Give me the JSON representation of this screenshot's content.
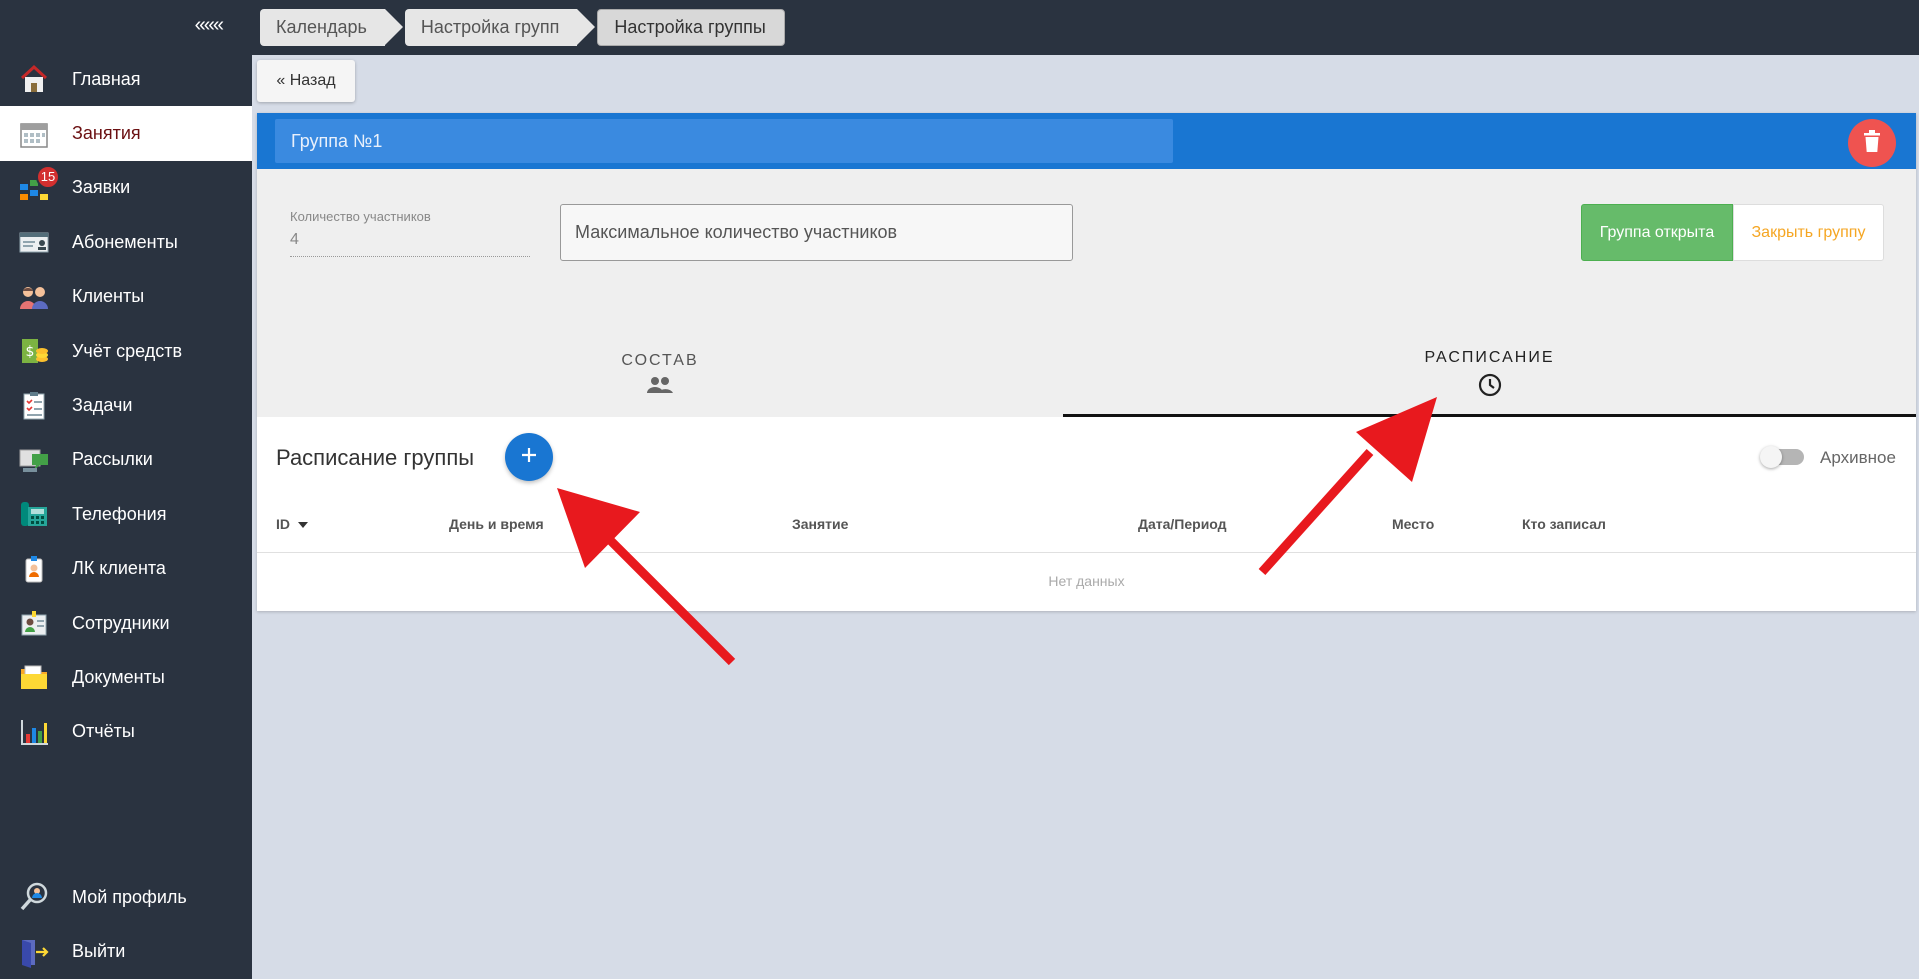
{
  "sidebar": {
    "collapse_label": "«««",
    "items": [
      {
        "label": "Главная",
        "icon": "home-icon"
      },
      {
        "label": "Занятия",
        "icon": "calendar-icon",
        "active": true
      },
      {
        "label": "Заявки",
        "icon": "requests-icon",
        "badge": "15"
      },
      {
        "label": "Абонементы",
        "icon": "subscription-card-icon"
      },
      {
        "label": "Клиенты",
        "icon": "clients-icon"
      },
      {
        "label": "Учёт средств",
        "icon": "money-icon"
      },
      {
        "label": "Задачи",
        "icon": "tasks-clipboard-icon"
      },
      {
        "label": "Рассылки",
        "icon": "mailing-icon"
      },
      {
        "label": "Телефония",
        "icon": "phone-icon"
      },
      {
        "label": "ЛК клиента",
        "icon": "client-account-icon"
      },
      {
        "label": "Сотрудники",
        "icon": "staff-icon"
      },
      {
        "label": "Документы",
        "icon": "documents-folder-icon"
      },
      {
        "label": "Отчёты",
        "icon": "reports-chart-icon"
      }
    ],
    "bottom_items": [
      {
        "label": "Мой профиль",
        "icon": "profile-icon"
      },
      {
        "label": "Выйти",
        "icon": "logout-icon"
      }
    ]
  },
  "breadcrumbs": [
    "Календарь",
    "Настройка групп",
    "Настройка группы"
  ],
  "back_label": "« Назад",
  "group": {
    "name": "Группа №1",
    "count_label": "Количество участников",
    "count_value": "4",
    "max_placeholder": "Максимальное количество участников",
    "open_label": "Группа открыта",
    "close_label": "Закрыть группу"
  },
  "tabs": [
    {
      "label": "СОСТАВ",
      "icon": "people-icon"
    },
    {
      "label": "РАСПИСАНИЕ",
      "icon": "clock-icon",
      "active": true
    }
  ],
  "schedule": {
    "title": "Расписание группы",
    "archive_label": "Архивное",
    "columns": [
      "ID",
      "День и время",
      "Занятие",
      "Дата/Период",
      "Место",
      "Кто записал"
    ],
    "empty_text": "Нет данных"
  },
  "colors": {
    "sidebar_bg": "#2a3340",
    "header_blue": "#1976d2",
    "active_text": "#6b1012",
    "open_green": "#66bb6a",
    "close_orange": "#f5a623",
    "delete_red": "#ef5350",
    "arrow_red": "#e8191e"
  }
}
